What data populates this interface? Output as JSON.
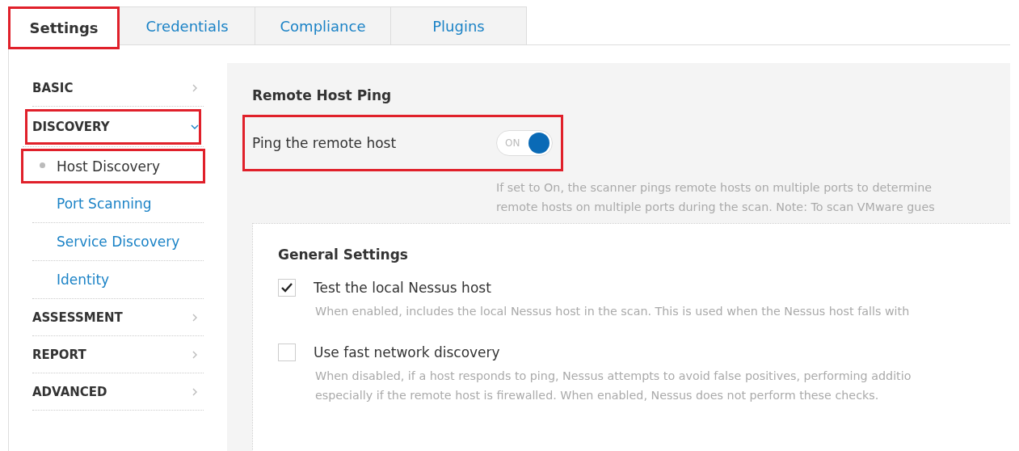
{
  "tabs": [
    {
      "label": "Settings",
      "selected": true,
      "highlighted": true
    },
    {
      "label": "Credentials",
      "selected": false,
      "highlighted": false
    },
    {
      "label": "Compliance",
      "selected": false,
      "highlighted": false
    },
    {
      "label": "Plugins",
      "selected": false,
      "highlighted": false
    }
  ],
  "sidebar": {
    "items": [
      {
        "label": "BASIC",
        "expanded": false,
        "highlighted": false
      },
      {
        "label": "DISCOVERY",
        "expanded": true,
        "highlighted": true,
        "children": [
          {
            "label": "Host Discovery",
            "selected": true,
            "highlighted": true
          },
          {
            "label": "Port Scanning",
            "selected": false,
            "highlighted": false
          },
          {
            "label": "Service Discovery",
            "selected": false,
            "highlighted": false
          },
          {
            "label": "Identity",
            "selected": false,
            "highlighted": false
          }
        ]
      },
      {
        "label": "ASSESSMENT",
        "expanded": false,
        "highlighted": false
      },
      {
        "label": "REPORT",
        "expanded": false,
        "highlighted": false
      },
      {
        "label": "ADVANCED",
        "expanded": false,
        "highlighted": false
      }
    ]
  },
  "section": {
    "title": "Remote Host Ping",
    "toggle": {
      "label": "Ping the remote host",
      "on": true,
      "state_text": "ON",
      "highlighted": true
    },
    "description": [
      "If set to On, the scanner pings remote hosts on multiple ports to determine",
      "remote hosts on multiple ports during the scan. Note: To scan VMware gues"
    ]
  },
  "general": {
    "title": "General Settings",
    "options": [
      {
        "label": "Test the local Nessus host",
        "checked": true,
        "description": [
          "When enabled, includes the local Nessus host in the scan. This is used when the Nessus host falls with"
        ]
      },
      {
        "label": "Use fast network discovery",
        "checked": false,
        "description": [
          "When disabled, if a host responds to ping, Nessus attempts to avoid false positives, performing additio",
          "especially if the remote host is firewalled. When enabled, Nessus does not perform these checks."
        ]
      }
    ]
  }
}
